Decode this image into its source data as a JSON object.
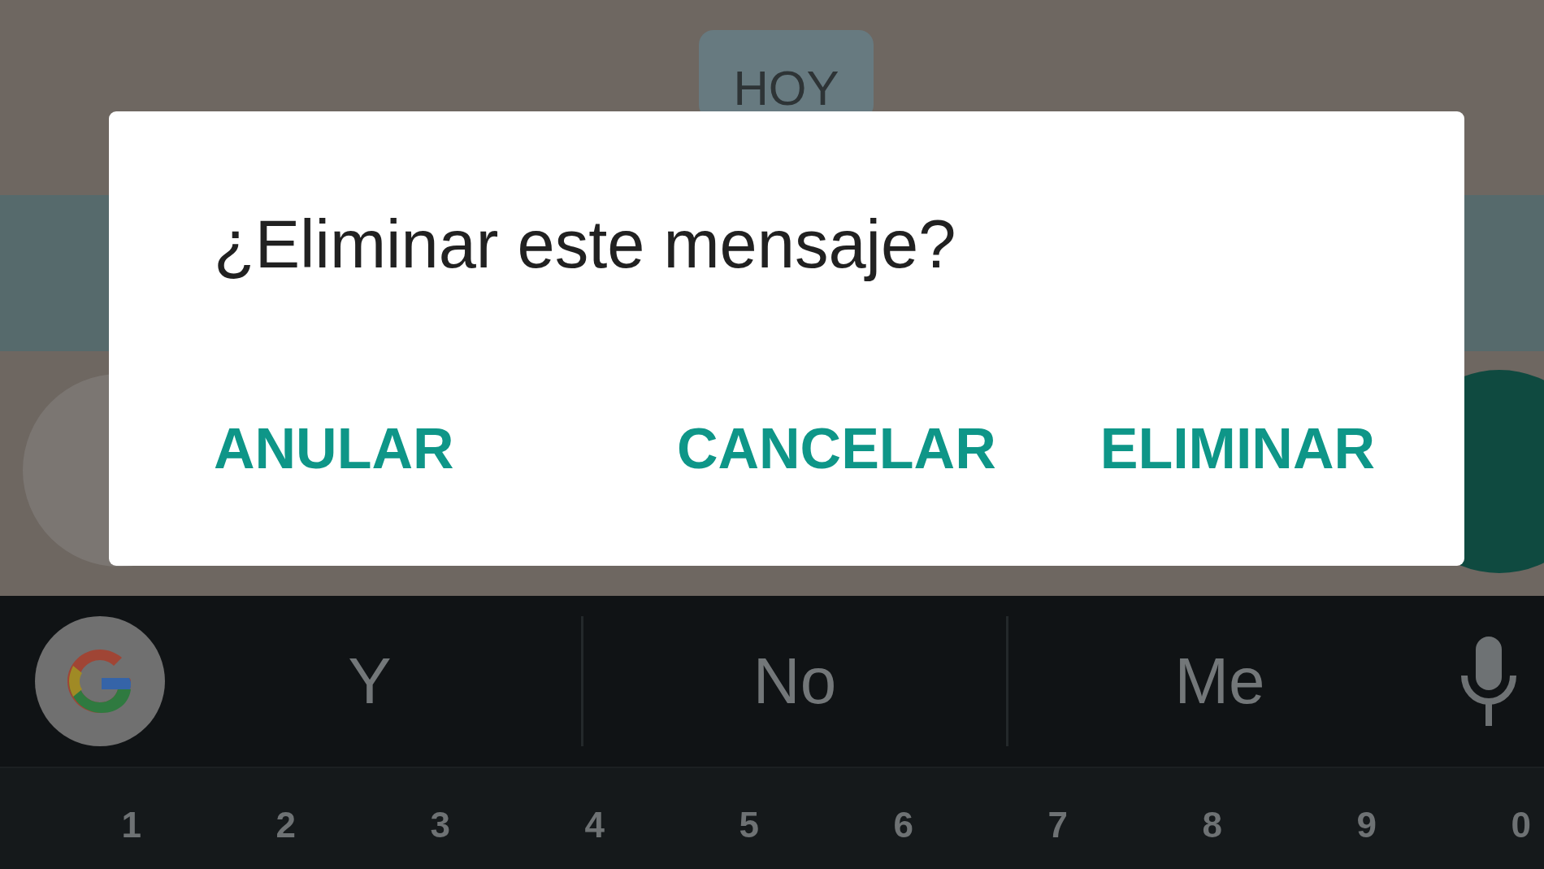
{
  "chat": {
    "date_chip": "HOY"
  },
  "dialog": {
    "title": "¿Eliminar este mensaje?",
    "buttons": [
      {
        "label": "ANULAR"
      },
      {
        "label": "CANCELAR"
      },
      {
        "label": "ELIMINAR"
      }
    ]
  },
  "keyboard": {
    "suggestions": [
      "Y",
      "No",
      "Me"
    ],
    "number_hints": [
      "1",
      "2",
      "3",
      "4",
      "5",
      "6",
      "7",
      "8",
      "9",
      "0"
    ]
  }
}
